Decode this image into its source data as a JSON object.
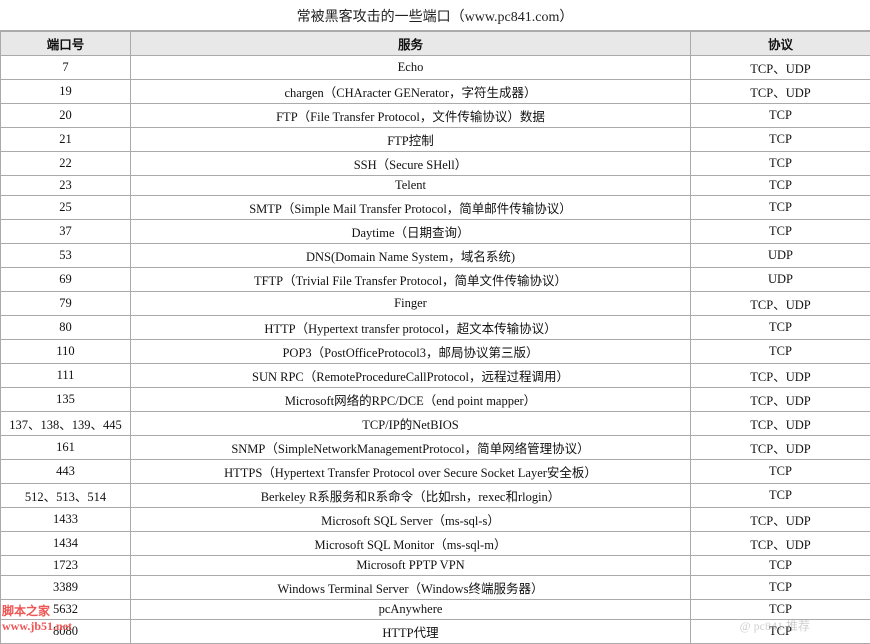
{
  "title": "常被黑客攻击的一些端口（www.pc841.com）",
  "headers": {
    "port": "端口号",
    "service": "服务",
    "protocol": "协议"
  },
  "rows": [
    {
      "port": "7",
      "service": "Echo",
      "protocol": "TCP、UDP"
    },
    {
      "port": "19",
      "service": "chargen（CHAracter GENerator，字符生成器）",
      "protocol": "TCP、UDP"
    },
    {
      "port": "20",
      "service": "FTP（File Transfer Protocol，文件传输协议）数据",
      "protocol": "TCP"
    },
    {
      "port": "21",
      "service": "FTP控制",
      "protocol": "TCP"
    },
    {
      "port": "22",
      "service": "SSH（Secure SHell）",
      "protocol": "TCP"
    },
    {
      "port": "23",
      "service": "Telent",
      "protocol": "TCP"
    },
    {
      "port": "25",
      "service": "SMTP（Simple Mail Transfer Protocol，简单邮件传输协议）",
      "protocol": "TCP"
    },
    {
      "port": "37",
      "service": "Daytime（日期查询）",
      "protocol": "TCP"
    },
    {
      "port": "53",
      "service": "DNS(Domain Name System，域名系统)",
      "protocol": "UDP"
    },
    {
      "port": "69",
      "service": "TFTP（Trivial File Transfer Protocol，简单文件传输协议）",
      "protocol": "UDP"
    },
    {
      "port": "79",
      "service": "Finger",
      "protocol": "TCP、UDP"
    },
    {
      "port": "80",
      "service": "HTTP（Hypertext transfer protocol，超文本传输协议）",
      "protocol": "TCP"
    },
    {
      "port": "110",
      "service": "POP3（PostOfficeProtocol3，邮局协议第三版）",
      "protocol": "TCP"
    },
    {
      "port": "111",
      "service": "SUN RPC（RemoteProcedureCallProtocol，远程过程调用）",
      "protocol": "TCP、UDP"
    },
    {
      "port": "135",
      "service": "Microsoft网络的RPC/DCE（end point mapper）",
      "protocol": "TCP、UDP"
    },
    {
      "port": "137、138、139、445",
      "service": "TCP/IP的NetBIOS",
      "protocol": "TCP、UDP"
    },
    {
      "port": "161",
      "service": "SNMP（SimpleNetworkManagementProtocol，简单网络管理协议）",
      "protocol": "TCP、UDP"
    },
    {
      "port": "443",
      "service": "HTTPS（Hypertext Transfer Protocol over Secure Socket Layer安全板）",
      "protocol": "TCP"
    },
    {
      "port": "512、513、514",
      "service": "Berkeley R系服务和R系命令（比如rsh，rexec和rlogin）",
      "protocol": "TCP"
    },
    {
      "port": "1433",
      "service": "Microsoft SQL Server（ms-sql-s）",
      "protocol": "TCP、UDP"
    },
    {
      "port": "1434",
      "service": "Microsoft SQL Monitor（ms-sql-m）",
      "protocol": "TCP、UDP"
    },
    {
      "port": "1723",
      "service": "Microsoft PPTP VPN",
      "protocol": "TCP"
    },
    {
      "port": "3389",
      "service": "Windows Terminal Server（Windows终端服务器）",
      "protocol": "TCP"
    },
    {
      "port": "5632",
      "service": "pcAnywhere",
      "protocol": "TCP"
    },
    {
      "port": "8080",
      "service": "HTTP代理",
      "protocol": "TCP"
    }
  ],
  "watermark_left": "脚本之家",
  "watermark_left2": "www.jb51.net",
  "watermark_right": "@ pc841 推荐"
}
